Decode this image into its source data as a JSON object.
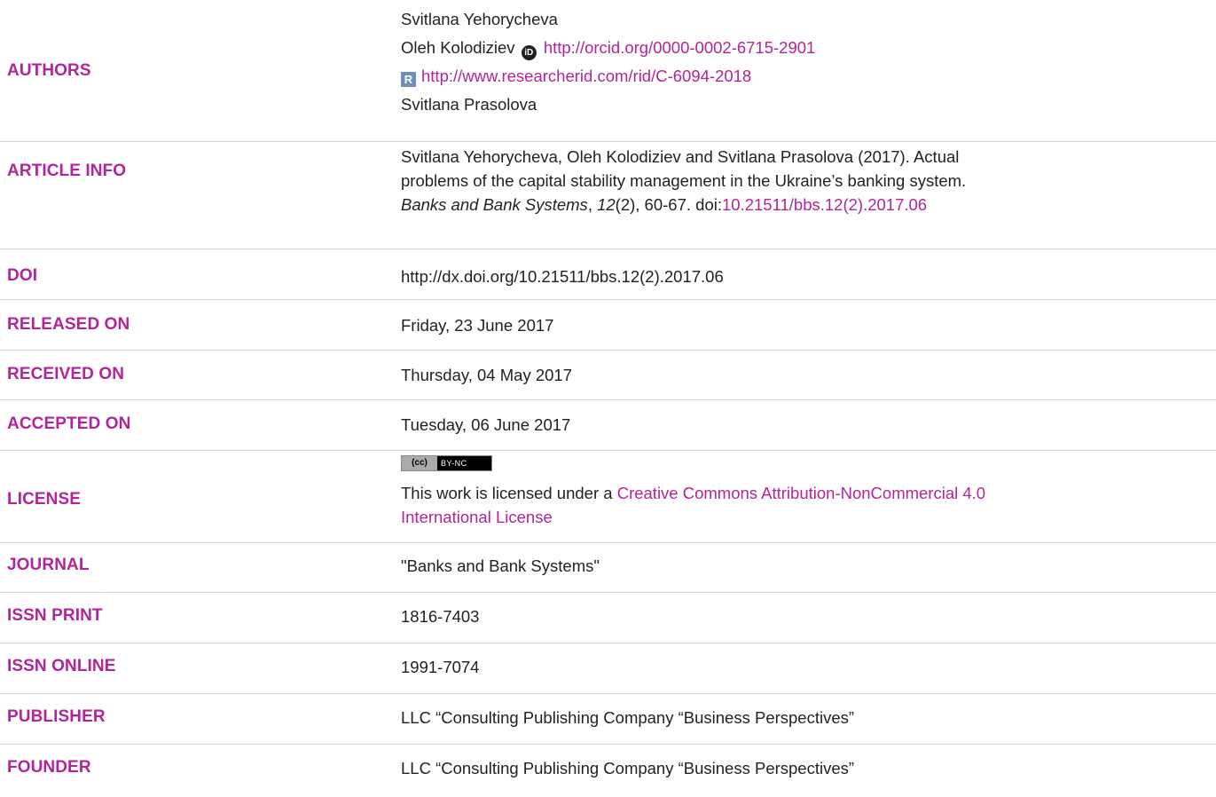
{
  "authors": {
    "label": "AUTHORS",
    "name1": "Svitlana Yehorycheva",
    "name2": "Oleh Kolodiziev",
    "orcid_url": "http://orcid.org/0000-0002-6715-2901",
    "researcherid_url": "http://www.researcherid.com/rid/C-6094-2018",
    "name3": "Svitlana Prasolova",
    "orcid_icon_text": "iD",
    "rid_icon_text": "R"
  },
  "article_info": {
    "label": "ARTICLE INFO",
    "line1": "Svitlana Yehorycheva, Oleh Kolodiziev and Svitlana Prasolova (2017). Actual",
    "line2": "problems of the capital stability management in the Ukraine’s banking system.",
    "journal": "Banks and Bank Systems",
    "sep1": ", ",
    "volume": "12",
    "issue_pages": "(2), 60-67. doi:",
    "doi_link": "10.21511/bbs.12(2).2017.06"
  },
  "doi": {
    "label": "DOI",
    "value": "http://dx.doi.org/10.21511/bbs.12(2).2017.06"
  },
  "released": {
    "label": "RELEASED ON",
    "value": "Friday, 23 June 2017"
  },
  "received": {
    "label": "RECEIVED ON",
    "value": "Thursday, 04 May 2017"
  },
  "accepted": {
    "label": "ACCEPTED ON",
    "value": "Tuesday, 06 June 2017"
  },
  "license": {
    "label": "LICENSE",
    "badge_left": "(cc)",
    "badge_right": "BY-NC",
    "text": "This work is licensed under a ",
    "link_line1": "Creative Commons Attribution-NonCommercial 4.0",
    "link_line2": "International License"
  },
  "journal": {
    "label": "JOURNAL",
    "value": "\"Banks and Bank Systems\""
  },
  "issn_print": {
    "label": "ISSN PRINT",
    "value": "1816-7403"
  },
  "issn_online": {
    "label": "ISSN ONLINE",
    "value": "1991-7074"
  },
  "publisher": {
    "label": "PUBLISHER",
    "value": "LLC “Consulting Publishing Company “Business Perspectives”"
  },
  "founder": {
    "label": "FOUNDER",
    "value": "LLC “Consulting Publishing Company “Business Perspectives”"
  },
  "colors": {
    "accent": "#b2249c",
    "text": "#231f20",
    "rule": "#d6d6d6"
  }
}
